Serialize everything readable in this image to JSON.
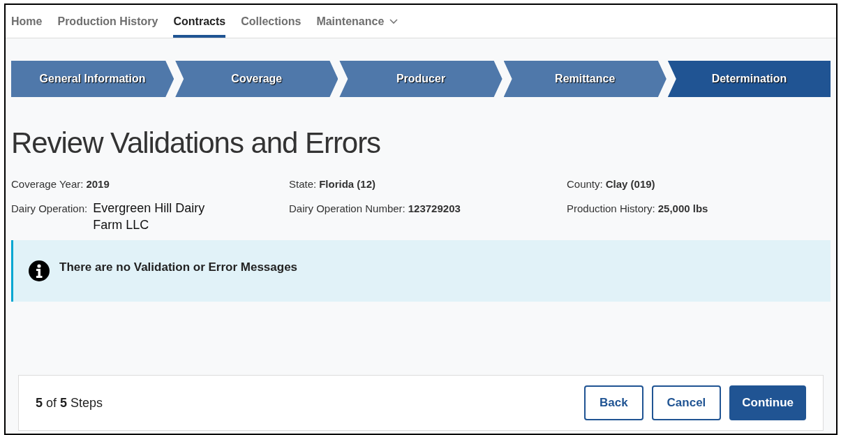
{
  "nav": [
    {
      "label": "Home",
      "selected": false
    },
    {
      "label": "Production History",
      "selected": false
    },
    {
      "label": "Contracts",
      "selected": true
    },
    {
      "label": "Collections",
      "selected": false
    },
    {
      "label": "Maintenance",
      "selected": false,
      "dropdown": true
    }
  ],
  "steps": [
    {
      "label": "General Information",
      "selected": false
    },
    {
      "label": "Coverage",
      "selected": false
    },
    {
      "label": "Producer",
      "selected": false
    },
    {
      "label": "Remittance",
      "selected": false
    },
    {
      "label": "Determination",
      "selected": true
    }
  ],
  "heading": "Review Validations and Errors",
  "fields": [
    {
      "label": "Coverage Year:",
      "value": "2019",
      "kind": "bold"
    },
    {
      "label": "State:",
      "value": "Florida (12)",
      "kind": "bold"
    },
    {
      "label": "County:",
      "value": "Clay (019)",
      "kind": "bold"
    },
    {
      "label": "Dairy Operation:",
      "value": "Evergreen Hill Dairy Farm LLC",
      "kind": "plain"
    },
    {
      "label": "Dairy Operation Number:",
      "value": "123729203",
      "kind": "bold"
    },
    {
      "label": "Production History:",
      "value": "25,000 lbs",
      "kind": "bold"
    }
  ],
  "alert": {
    "message": "There are no Validation or Error Messages"
  },
  "footer": {
    "progress": "**5** of **5** Steps",
    "buttons": [
      {
        "label": "Back",
        "kind": "outline"
      },
      {
        "label": "Cancel",
        "kind": "outline"
      },
      {
        "label": "Continue",
        "kind": "primary"
      }
    ]
  }
}
